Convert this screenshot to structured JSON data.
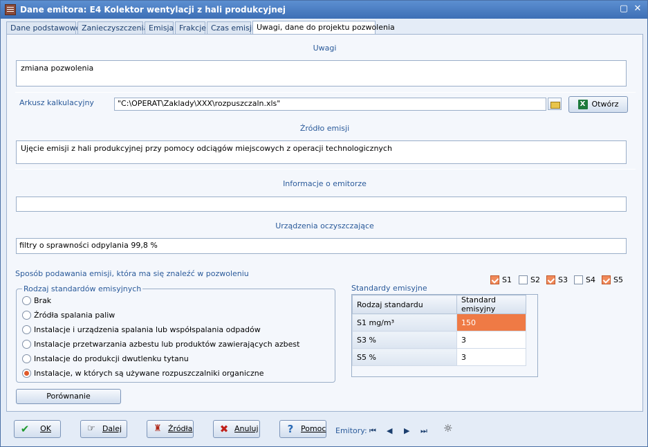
{
  "window": {
    "title": "Dane emitora: E4 Kolektor wentylacji z hali produkcyjnej"
  },
  "tabs": [
    {
      "label": "Dane podstawowe"
    },
    {
      "label": "Zanieczyszczenia"
    },
    {
      "label": "Emisja"
    },
    {
      "label": "Frakcje"
    },
    {
      "label": "Czas emisji"
    },
    {
      "label": "Uwagi, dane do projektu pozwolenia"
    }
  ],
  "uwagi": {
    "label": "Uwagi",
    "value": "zmiana pozwolenia"
  },
  "arkusz": {
    "label": "Arkusz kalkulacyjny",
    "value": "\"C:\\OPERAT\\Zaklady\\XXX\\rozpuszczaln.xls\"",
    "open_button": "Otwórz"
  },
  "zrodlo": {
    "label": "Źródło emisji",
    "value": "Ujęcie emisji z hali produkcyjnej przy pomocy odciągów miejscowych z operacji technologicznych"
  },
  "informacje": {
    "label": "Informacje o emitorze",
    "value": ""
  },
  "urzadzenia": {
    "label": "Urządzenia oczyszczające",
    "value": "filtry o sprawności odpylania 99,8 %"
  },
  "sposob": {
    "label": "Sposób podawania emisji, która ma się znaleźć w pozwoleniu"
  },
  "checkboxes": [
    {
      "label": "S1",
      "checked": true
    },
    {
      "label": "S2",
      "checked": false
    },
    {
      "label": "S3",
      "checked": true
    },
    {
      "label": "S4",
      "checked": false
    },
    {
      "label": "S5",
      "checked": true
    }
  ],
  "rodzaj": {
    "label": "Rodzaj standardów emisyjnych",
    "options": [
      {
        "label": "Brak",
        "checked": false
      },
      {
        "label": "Źródła spalania paliw",
        "checked": false
      },
      {
        "label": "Instalacje i urządzenia spalania lub współspalania odpadów",
        "checked": false
      },
      {
        "label": "Instalacje przetwarzania azbestu lub produktów zawierających azbest",
        "checked": false
      },
      {
        "label": "Instalacje do produkcji dwutlenku tytanu",
        "checked": false
      },
      {
        "label": "Instalacje, w których są używane rozpuszczalniki organiczne",
        "checked": true
      }
    ]
  },
  "porownanie_button": "Porównanie",
  "standardy": {
    "label": "Standardy emisyjne",
    "columns": [
      "Rodzaj standardu",
      "Standard emisyjny"
    ],
    "rows": [
      {
        "name": "S1 mg/m³",
        "value": "150"
      },
      {
        "name": "S3 %",
        "value": "3"
      },
      {
        "name": "S5 %",
        "value": "3"
      }
    ]
  },
  "bottom": {
    "ok": "OK",
    "dalej": "Dalej",
    "zrodla": "Źródła",
    "anuluj": "Anuluj",
    "pomoc": "Pomoc",
    "emitory_label": "Emitory:"
  },
  "colors": {
    "accent": "#ef7a45",
    "title_bar": "#3d6fb5",
    "label_blue": "#2a5a9a"
  }
}
